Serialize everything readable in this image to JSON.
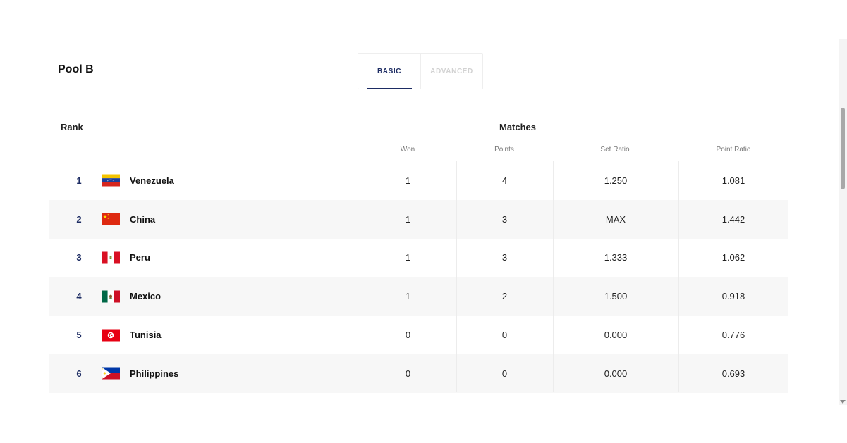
{
  "pool_title": "Pool B",
  "tabs": [
    {
      "label": "BASIC",
      "active": true
    },
    {
      "label": "ADVANCED",
      "active": false
    }
  ],
  "header": {
    "rank": "Rank",
    "matches": "Matches",
    "won": "Won",
    "points": "Points",
    "set_ratio": "Set Ratio",
    "point_ratio": "Point Ratio"
  },
  "rows": [
    {
      "rank": "1",
      "team": "Venezuela",
      "won": "1",
      "points": "4",
      "set_ratio": "1.250",
      "point_ratio": "1.081",
      "flag": "venezuela-flag-icon"
    },
    {
      "rank": "2",
      "team": "China",
      "won": "1",
      "points": "3",
      "set_ratio": "MAX",
      "point_ratio": "1.442",
      "flag": "china-flag-icon"
    },
    {
      "rank": "3",
      "team": "Peru",
      "won": "1",
      "points": "3",
      "set_ratio": "1.333",
      "point_ratio": "1.062",
      "flag": "peru-flag-icon"
    },
    {
      "rank": "4",
      "team": "Mexico",
      "won": "1",
      "points": "2",
      "set_ratio": "1.500",
      "point_ratio": "0.918",
      "flag": "mexico-flag-icon"
    },
    {
      "rank": "5",
      "team": "Tunisia",
      "won": "0",
      "points": "0",
      "set_ratio": "0.000",
      "point_ratio": "0.776",
      "flag": "tunisia-flag-icon"
    },
    {
      "rank": "6",
      "team": "Philippines",
      "won": "0",
      "points": "0",
      "set_ratio": "0.000",
      "point_ratio": "0.693",
      "flag": "philippines-flag-icon"
    }
  ],
  "colors": {
    "accent": "#1d2c63",
    "row_alt": "#f7f7f7",
    "tab_inactive": "#d2d2d2"
  }
}
